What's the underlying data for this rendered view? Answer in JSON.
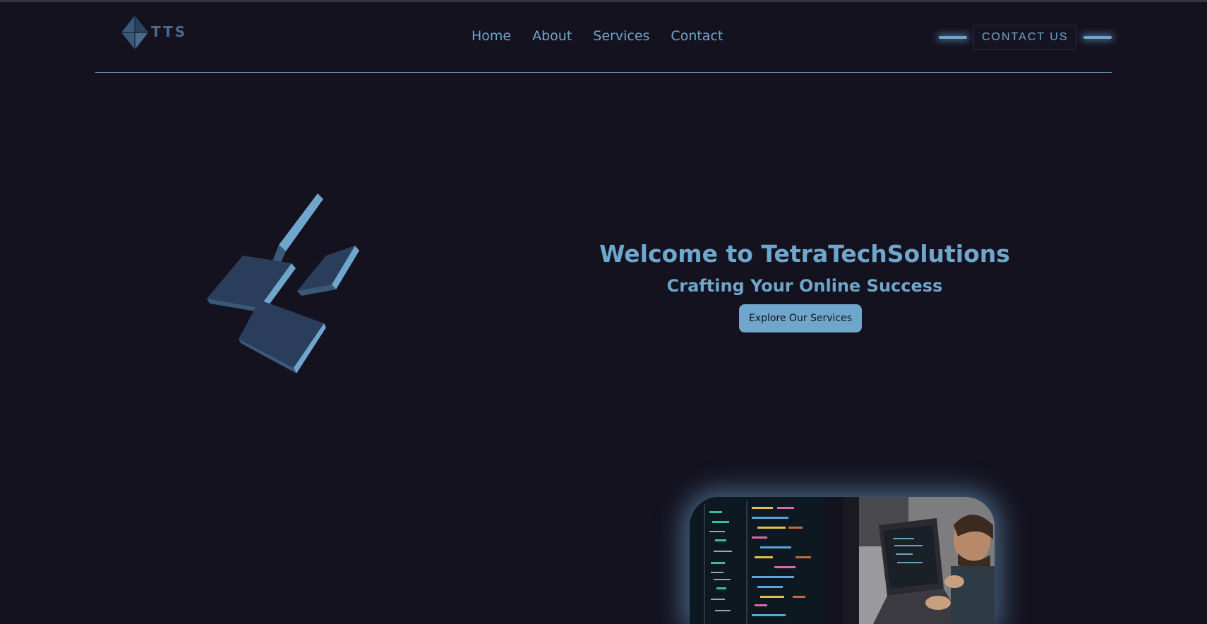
{
  "brand": {
    "logo_text": "TTS"
  },
  "nav": {
    "links": [
      "Home",
      "About",
      "Services",
      "Contact"
    ]
  },
  "header": {
    "contact_label": "CONTACT US"
  },
  "hero": {
    "title": "Welcome to TetraTechSolutions",
    "subtitle": "Crafting Your Online Success",
    "cta_label": "Explore Our Services"
  },
  "colors": {
    "background": "#14121f",
    "accent": "#6fa6cc",
    "shape_dark": "#2a3d5a",
    "shape_light": "#6fa6cc"
  },
  "icons": {
    "logo": "diamond-logo-icon",
    "hero_graphic": "tetra-pieces-graphic"
  }
}
